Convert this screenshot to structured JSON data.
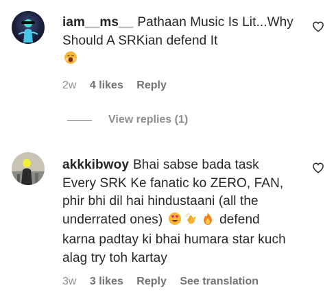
{
  "comments": [
    {
      "username": "iam__ms__",
      "text_before_emoji": "Pathaan Music Is Lit...Why Should A SRKian defend It",
      "emojis": [
        "yawning-face-emoji"
      ],
      "time": "2w",
      "likes": "4 likes",
      "reply_label": "Reply",
      "view_replies": "View replies (1)"
    },
    {
      "username": "akkkibwoy",
      "text_before_emoji": "Bhai sabse bada task Every SRK Ke fanatic ko ZERO, FAN, phir bhi dil hai hindustaani (all the underrated ones)",
      "emojis": [
        "heart-eyes-emoji",
        "clapping-hands-emoji",
        "fire-emoji"
      ],
      "text_after_emoji": "defend karna padtay ki bhai humara star kuch alag try toh kartay",
      "time": "3w",
      "likes": "3 likes",
      "reply_label": "Reply",
      "translation_label": "See translation"
    }
  ],
  "colors": {
    "text": "#262626",
    "meta": "#8e8e8e"
  }
}
